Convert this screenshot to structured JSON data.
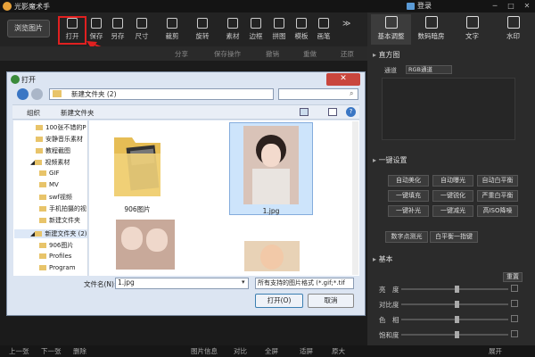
{
  "app": {
    "title": "光影魔术手",
    "login": "登录"
  },
  "toolbar": {
    "browse": "浏览图片",
    "open": "打开",
    "save": "保存",
    "saveas": "另存",
    "size": "尺寸",
    "crop": "裁剪",
    "rotate": "旋转",
    "material": "素材",
    "border": "边框",
    "collage": "拼图",
    "template": "模板",
    "annotate": "画笔"
  },
  "subtoolbar": {
    "share": "分享",
    "saved": "保存操作",
    "undo": "撤销",
    "redo": "重做",
    "restore": "还原"
  },
  "righttabs": {
    "basic": "基本调整",
    "digital": "数码暗房",
    "text": "文字",
    "watermark": "水印"
  },
  "panel": {
    "histogram": "直方图",
    "channel": "通道",
    "channel_val": "RGB通道",
    "oneclick": "一键设置",
    "buttons": [
      "自动美化",
      "自动曝光",
      "自动白平衡",
      "一键填充",
      "一键锐化",
      "严重白平衡",
      "一键补光",
      "一键减光",
      "高ISO降噪",
      "数字点测光",
      "白平衡一指键"
    ],
    "basic": "基本",
    "reset": "重置",
    "sliders": [
      "亮　度",
      "对比度",
      "色　相",
      "饱和度"
    ]
  },
  "dialog": {
    "title": "打开",
    "path": "新建文件夹 (2)",
    "organize": "组织",
    "newfolder": "新建文件夹",
    "tree": [
      "100张不错的P",
      "安静音乐素材",
      "教程截图",
      "视频素材",
      "GIF",
      "MV",
      "swf视频",
      "手机拍摄的视",
      "新建文件夹",
      "新建文件夹 (2)",
      "906图片",
      "Profiles",
      "Program"
    ],
    "files": [
      "906图片",
      "1.jpg"
    ],
    "filename_label": "文件名(N):",
    "filename": "1.jpg",
    "filter": "所有支持的图片格式 (*.gif;*.tif",
    "open": "打开(O)",
    "cancel": "取消"
  },
  "bottom": {
    "prev": "上一张",
    "next": "下一张",
    "delete": "删除",
    "info": "图片信息",
    "compare": "对比",
    "fullscreen": "全屏",
    "fit": "适屏",
    "original": "原大",
    "expand": "展开"
  },
  "colors": {
    "accent": "#e02020",
    "selection": "#cde4fb"
  }
}
